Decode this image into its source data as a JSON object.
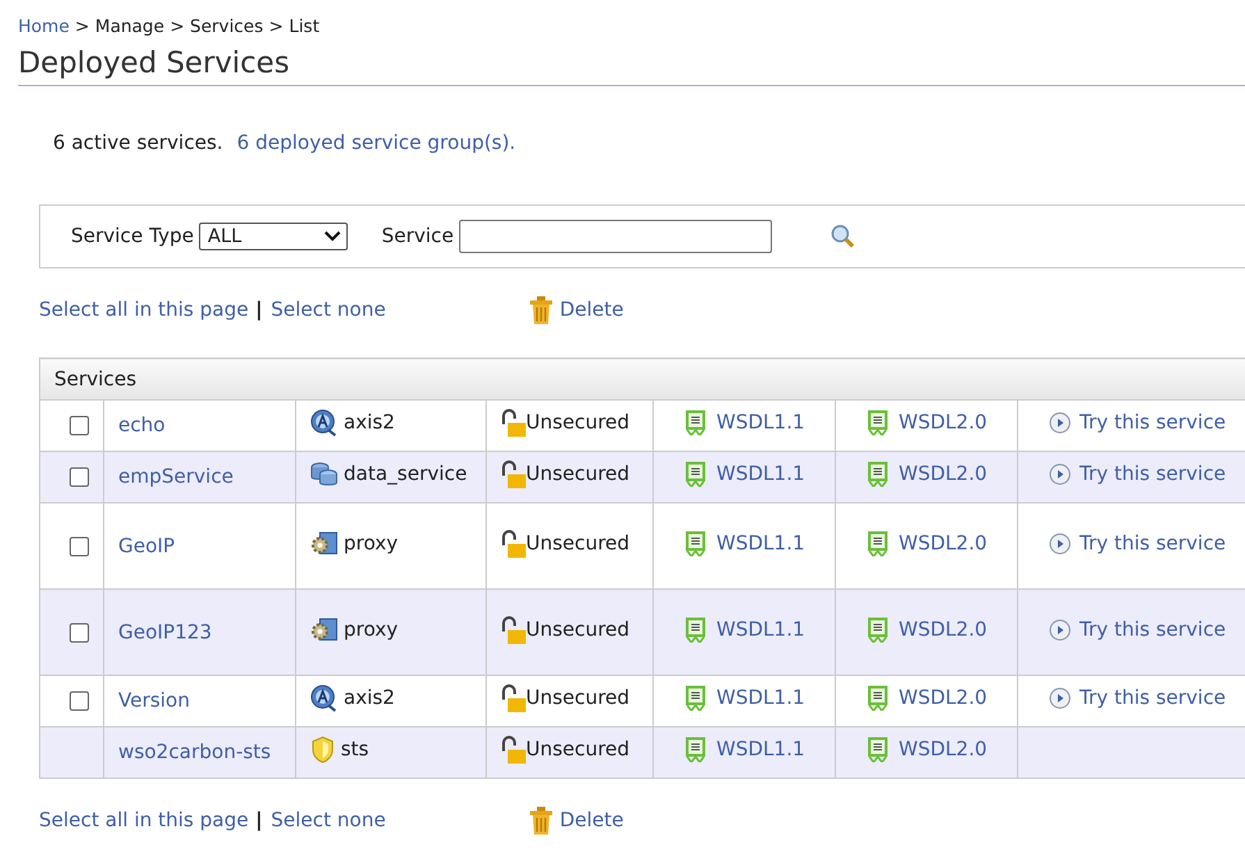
{
  "breadcrumb": [
    {
      "label": "Home",
      "link": true
    },
    {
      "label": "Manage",
      "link": false
    },
    {
      "label": "Services",
      "link": false
    },
    {
      "label": "List",
      "link": false
    }
  ],
  "breadcrumb_separator": ">",
  "title": "Deployed Services",
  "summary": {
    "text": "6 active services.",
    "link": "6 deployed service group(s)."
  },
  "filter": {
    "type_label": "Service Type",
    "type_value": "ALL",
    "service_label": "Service"
  },
  "selection_top": {
    "select_all": "Select all in this page",
    "separator": "|",
    "select_none": "Select none",
    "delete": "Delete"
  },
  "table": {
    "header": "Services",
    "rows": [
      {
        "name": "echo",
        "kind": "axis2",
        "type": "axis2",
        "selectable": true,
        "checked": false,
        "security": "Unsecured",
        "wsdl11": "WSDL1.1",
        "wsdl20": "WSDL2.0",
        "try": "Try this service"
      },
      {
        "name": "empService",
        "kind": "data_service",
        "type": "data_service",
        "selectable": true,
        "checked": false,
        "security": "Unsecured",
        "wsdl11": "WSDL1.1",
        "wsdl20": "WSDL2.0",
        "try": "Try this service"
      },
      {
        "name": "GeoIP",
        "kind": "proxy",
        "type": "proxy",
        "selectable": true,
        "checked": false,
        "security": "Unsecured",
        "wsdl11": "WSDL1.1",
        "wsdl20": "WSDL2.0",
        "try": "Try this service"
      },
      {
        "name": "GeoIP123",
        "kind": "proxy",
        "type": "proxy",
        "selectable": true,
        "checked": false,
        "security": "Unsecured",
        "wsdl11": "WSDL1.1",
        "wsdl20": "WSDL2.0",
        "try": "Try this service"
      },
      {
        "name": "Version",
        "kind": "axis2",
        "type": "axis2",
        "selectable": true,
        "checked": false,
        "security": "Unsecured",
        "wsdl11": "WSDL1.1",
        "wsdl20": "WSDL2.0",
        "try": "Try this service"
      },
      {
        "name": "wso2carbon-sts",
        "kind": "sts",
        "type": "sts",
        "selectable": false,
        "security": "Unsecured",
        "wsdl11": "WSDL1.1",
        "wsdl20": "WSDL2.0"
      }
    ]
  },
  "selection_bottom": {
    "select_all": "Select all in this page",
    "separator": "|",
    "select_none": "Select none",
    "delete": "Delete"
  }
}
